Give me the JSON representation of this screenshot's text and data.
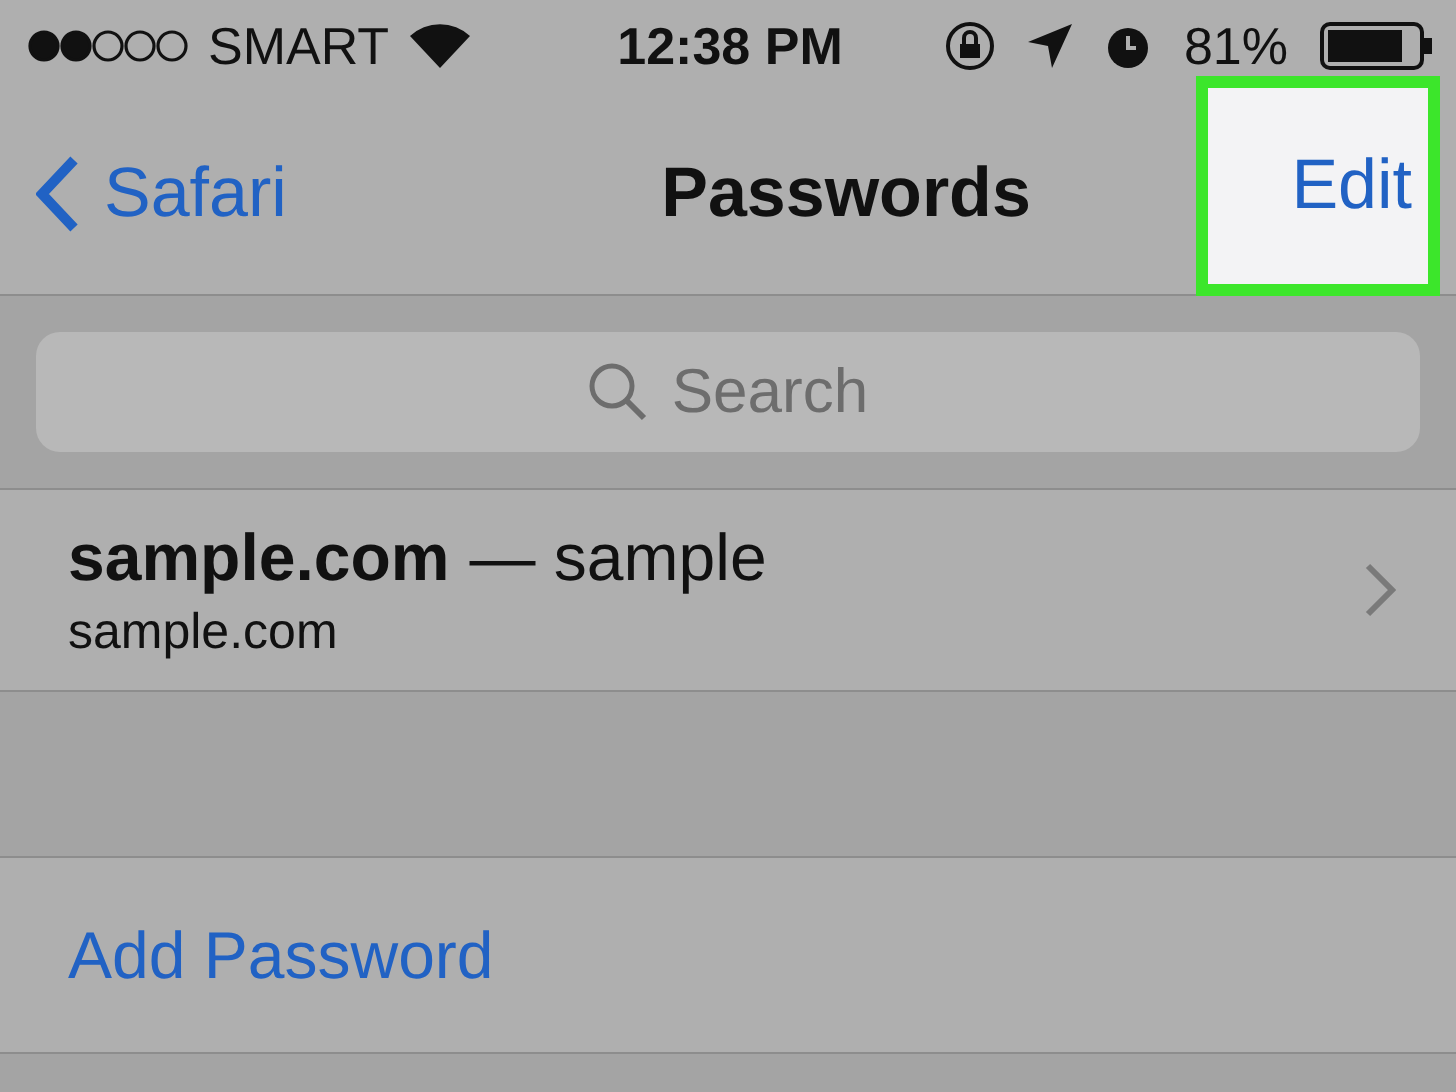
{
  "status_bar": {
    "carrier": "SMART",
    "time": "12:38 PM",
    "battery": "81%"
  },
  "nav_bar": {
    "back": "Safari",
    "title": "Passwords",
    "edit": {
      "label": "Edit",
      "highlighted": true
    }
  },
  "search": {
    "placeholder": "Search"
  },
  "passwords": [
    {
      "site": "sample.com",
      "user": "— sample",
      "detail": "sample.com"
    }
  ],
  "add_password": "Add Password"
}
